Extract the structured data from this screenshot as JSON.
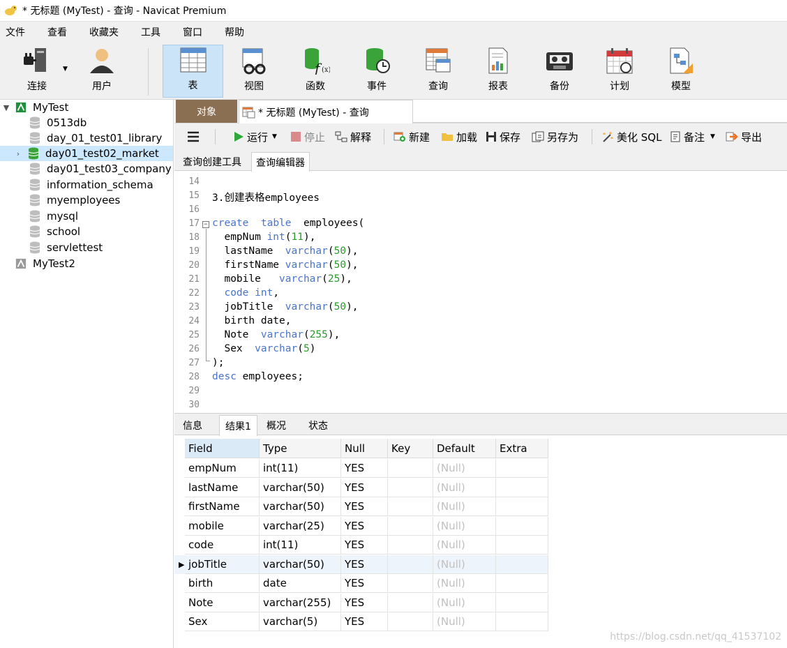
{
  "window": {
    "title": "* 无标题 (MyTest) - 查询 - Navicat Premium"
  },
  "menu": [
    "文件",
    "查看",
    "收藏夹",
    "工具",
    "窗口",
    "帮助"
  ],
  "toolbar": {
    "connect": "连接",
    "user": "用户",
    "table": "表",
    "view": "视图",
    "function": "函数",
    "event": "事件",
    "query": "查询",
    "report": "报表",
    "backup": "备份",
    "schedule": "计划",
    "model": "模型"
  },
  "tree": {
    "connection1": "MyTest",
    "databases": [
      "0513db",
      "day_01_test01_library",
      "day01_test02_market",
      "day01_test03_company",
      "information_schema",
      "myemployees",
      "mysql",
      "school",
      "servlettest"
    ],
    "connection2": "MyTest2"
  },
  "tabs": {
    "objects": "对象",
    "query": "* 无标题 (MyTest) - 查询"
  },
  "edit_toolbar": {
    "run": "运行",
    "stop": "停止",
    "explain": "解释",
    "new": "新建",
    "load": "加载",
    "save": "保存",
    "save_as": "另存为",
    "beautify": "美化 SQL",
    "note": "备注",
    "export": "导出"
  },
  "subtabs": {
    "builder": "查询创建工具",
    "editor": "查询编辑器"
  },
  "editor": {
    "line_numbers": [
      "14",
      "15",
      "16",
      "17",
      "18",
      "19",
      "20",
      "21",
      "22",
      "23",
      "24",
      "25",
      "26",
      "27",
      "28",
      "29",
      "30"
    ]
  },
  "result_tabs": {
    "info": "信息",
    "result1": "结果1",
    "profile": "概况",
    "status": "状态"
  },
  "grid": {
    "columns": [
      "Field",
      "Type",
      "Null",
      "Key",
      "Default",
      "Extra"
    ],
    "rows": [
      [
        "empNum",
        "int(11)",
        "YES",
        "",
        "(Null)",
        ""
      ],
      [
        "lastName",
        "varchar(50)",
        "YES",
        "",
        "(Null)",
        ""
      ],
      [
        "firstName",
        "varchar(50)",
        "YES",
        "",
        "(Null)",
        ""
      ],
      [
        "mobile",
        "varchar(25)",
        "YES",
        "",
        "(Null)",
        ""
      ],
      [
        "code",
        "int(11)",
        "YES",
        "",
        "(Null)",
        ""
      ],
      [
        "jobTitle",
        "varchar(50)",
        "YES",
        "",
        "(Null)",
        ""
      ],
      [
        "birth",
        "date",
        "YES",
        "",
        "(Null)",
        ""
      ],
      [
        "Note",
        "varchar(255)",
        "YES",
        "",
        "(Null)",
        ""
      ],
      [
        "Sex",
        "varchar(5)",
        "YES",
        "",
        "(Null)",
        ""
      ]
    ],
    "current_row": "jobTitle"
  },
  "watermark": "https://blog.csdn.net/qq_41537102",
  "colors": {
    "accent": "#cce4f7",
    "objects_tab": "#8b6f52",
    "keyword": "#4a74c9",
    "number": "#2b9a2b"
  }
}
